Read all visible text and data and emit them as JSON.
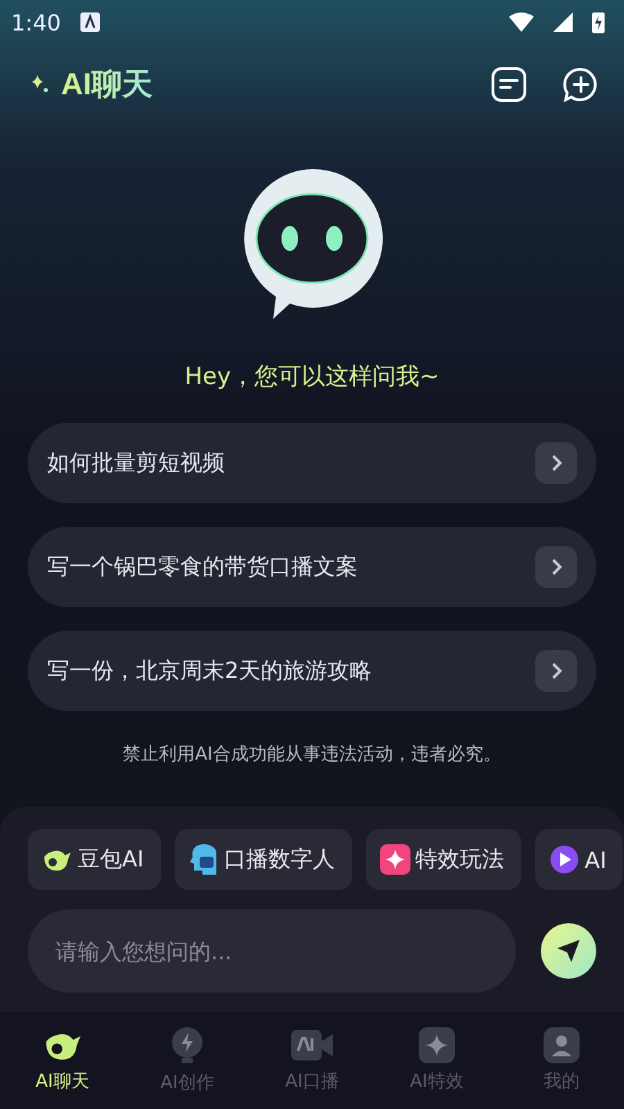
{
  "status_bar": {
    "time": "1:40"
  },
  "header": {
    "title": "AI聊天"
  },
  "greeting": "Hey，您可以这样问我~",
  "suggestions": [
    {
      "text": "如何批量剪短视频"
    },
    {
      "text": "写一个锅巴零食的带货口播文案"
    },
    {
      "text": "写一份，北京周末2天的旅游攻略"
    }
  ],
  "disclaimer": "禁止利用AI合成功能从事违法活动，违者必究。",
  "chips": [
    {
      "label": "豆包AI",
      "kind": "whale"
    },
    {
      "label": "口播数字人",
      "kind": "head"
    },
    {
      "label": "特效玩法",
      "kind": "sparkle"
    },
    {
      "label": "AI",
      "kind": "play"
    }
  ],
  "input": {
    "placeholder": "请输入您想问的..."
  },
  "tabs": [
    {
      "label": "AI聊天",
      "kind": "whale",
      "selected": true
    },
    {
      "label": "AI创作",
      "kind": "bolt",
      "selected": false
    },
    {
      "label": "AI口播",
      "kind": "camera",
      "selected": false
    },
    {
      "label": "AI特效",
      "kind": "sparkle",
      "selected": false
    },
    {
      "label": "我的",
      "kind": "person",
      "selected": false
    }
  ]
}
